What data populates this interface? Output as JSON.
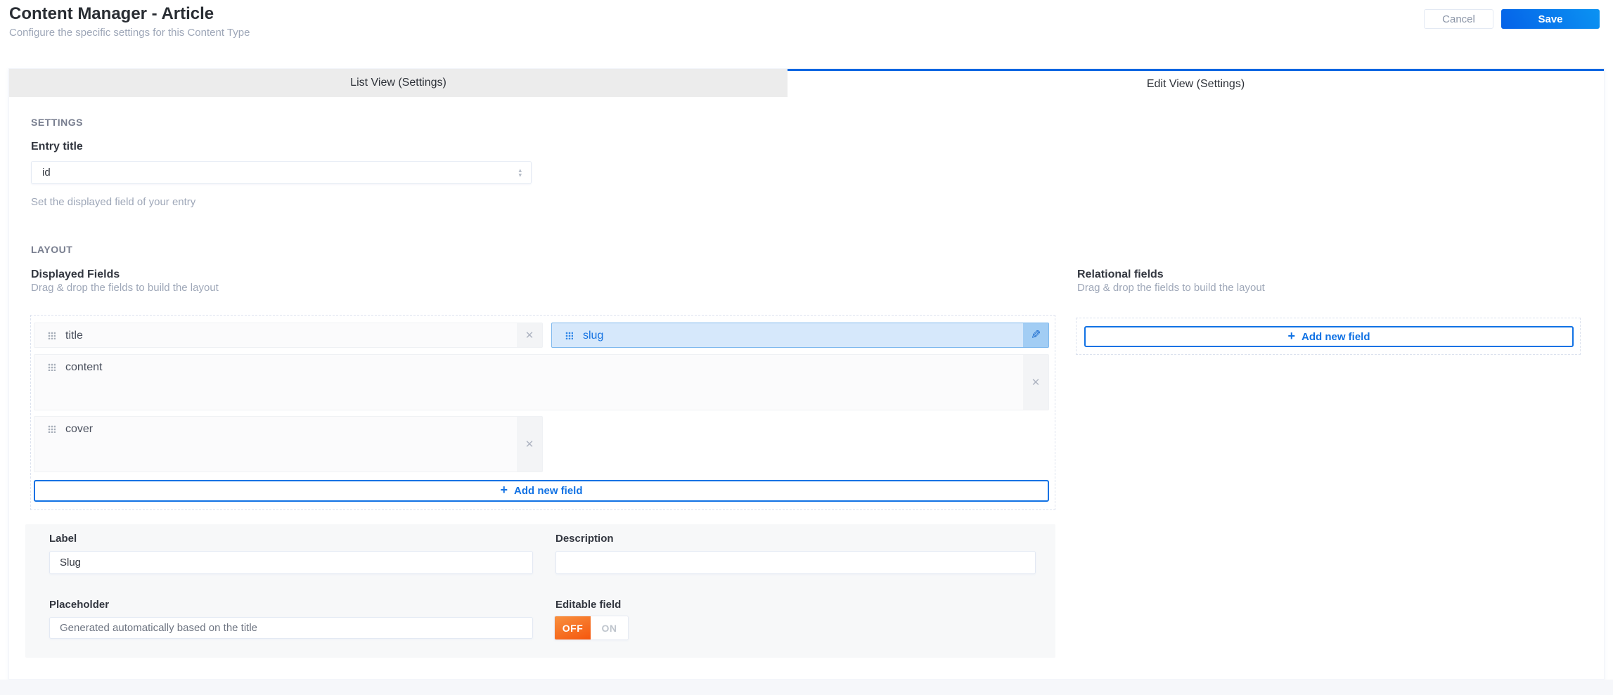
{
  "header": {
    "title": "Content Manager - Article",
    "subtitle": "Configure the specific settings for this Content Type",
    "cancel_label": "Cancel",
    "save_label": "Save"
  },
  "tabs": {
    "list_view": "List View (Settings)",
    "edit_view": "Edit View (Settings)",
    "active_tab": "Edit View (Settings)"
  },
  "settings": {
    "section_title": "SETTINGS",
    "entry_title": {
      "label": "Entry title",
      "value": "id",
      "help": "Set the displayed field of your entry"
    }
  },
  "layout": {
    "section_title": "LAYOUT",
    "displayed_fields": {
      "title": "Displayed Fields",
      "subtitle": "Drag & drop the fields to build the layout",
      "fields": [
        {
          "name": "title"
        },
        {
          "name": "slug",
          "state": "selected"
        },
        {
          "name": "content"
        },
        {
          "name": "cover"
        }
      ],
      "add_button": "Add new field"
    },
    "relational_fields": {
      "title": "Relational fields",
      "subtitle": "Drag & drop the fields to build the layout",
      "add_button": "Add new field"
    }
  },
  "field_editor": {
    "label": {
      "label": "Label",
      "value": "Slug"
    },
    "description": {
      "label": "Description",
      "value": ""
    },
    "placeholder": {
      "label": "Placeholder",
      "value": "Generated automatically based on the title"
    },
    "editable": {
      "label": "Editable field",
      "off": "OFF",
      "on": "ON",
      "value": "OFF"
    }
  },
  "icons": {
    "close": "✕",
    "edit_pencil": "✎",
    "plus": "+",
    "caret_up": "▴",
    "caret_down": "▾"
  },
  "colors": {
    "primary_blue": "#1172e4",
    "tab_active_border": "#0b66e2",
    "save_gradient_start": "#0562e8",
    "save_gradient_end": "#0b93f2",
    "selected_field_bg": "#d6e8fb",
    "selected_field_border": "#7fb9ee",
    "toggle_off_gradient_start": "#f8903f",
    "toggle_off_gradient_end": "#f5560d"
  }
}
